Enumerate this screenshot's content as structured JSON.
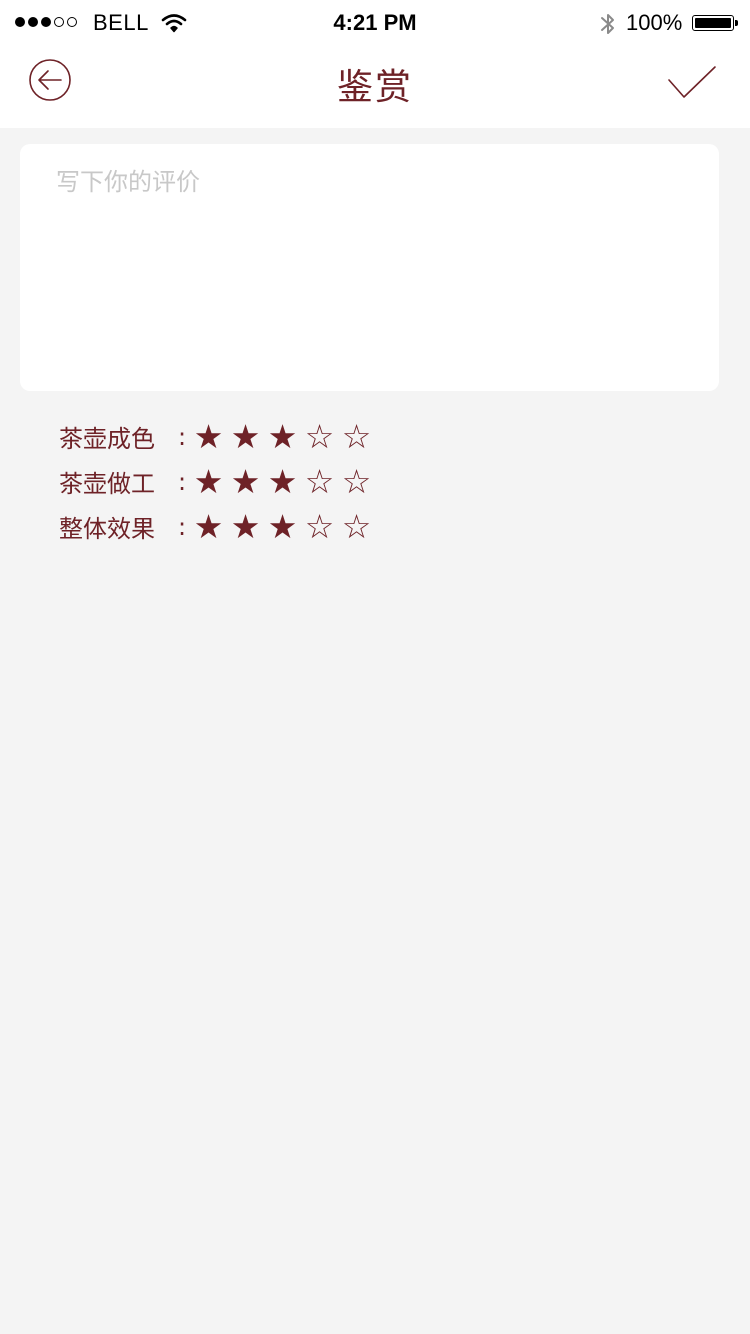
{
  "status_bar": {
    "signal_dots_filled": 3,
    "signal_dots_total": 5,
    "carrier": "BELL",
    "time": "4:21 PM",
    "battery_percent": "100%"
  },
  "nav": {
    "title": "鉴赏",
    "back_icon": "circle-arrow-left-icon",
    "confirm_icon": "checkmark-icon"
  },
  "review": {
    "value": "",
    "placeholder": "写下你的评价"
  },
  "ratings": [
    {
      "label": "茶壶成色",
      "colon": ":",
      "score": 3,
      "max": 5
    },
    {
      "label": "茶壶做工",
      "colon": ":",
      "score": 3,
      "max": 5
    },
    {
      "label": "整体效果",
      "colon": ":",
      "score": 3,
      "max": 5
    }
  ],
  "colors": {
    "accent": "#6e2227",
    "background": "#f4f4f4",
    "surface": "#ffffff",
    "placeholder": "#c8c8c8"
  }
}
